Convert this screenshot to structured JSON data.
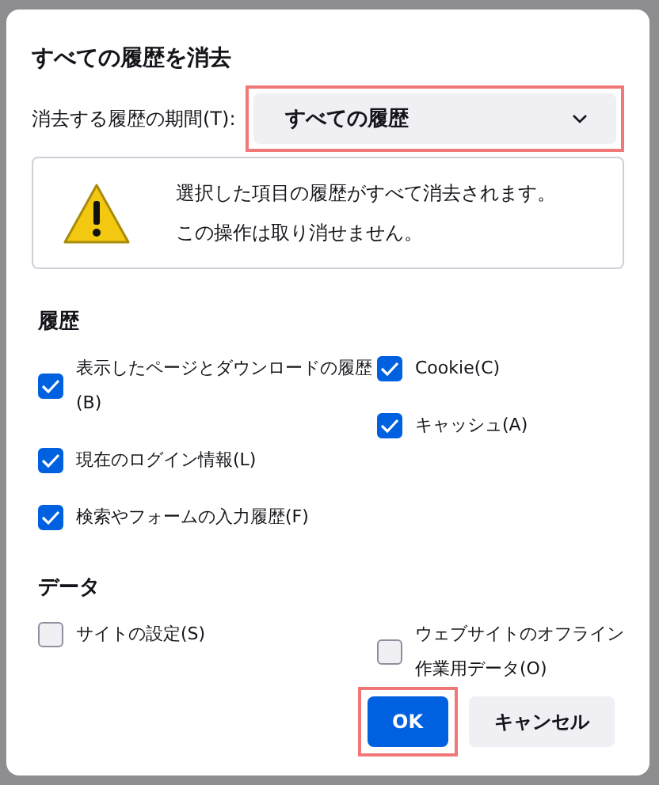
{
  "dialog": {
    "title": "すべての履歴を消去",
    "range": {
      "label": "消去する履歴の期間(T):",
      "value": "すべての履歴",
      "highlighted": true
    },
    "warning": {
      "lines": [
        "選択した項目の履歴がすべて消去されます。",
        "この操作は取り消せません。"
      ]
    },
    "sections": [
      {
        "title": "履歴",
        "columns": [
          [
            {
              "label": "表示したページとダウンロードの履歴(B)",
              "checked": true
            },
            {
              "label": "現在のログイン情報(L)",
              "checked": true
            },
            {
              "label": "検索やフォームの入力履歴(F)",
              "checked": true
            }
          ],
          [
            {
              "label": "Cookie(C)",
              "checked": true
            },
            {
              "label": "キャッシュ(A)",
              "checked": true
            }
          ]
        ]
      },
      {
        "title": "データ",
        "columns": [
          [
            {
              "label": "サイトの設定(S)",
              "checked": false
            }
          ],
          [
            {
              "label": "ウェブサイトのオフライン作業用データ(O)",
              "checked": false
            }
          ]
        ]
      }
    ],
    "buttons": [
      {
        "label": "OK",
        "kind": "primary",
        "highlighted": true
      },
      {
        "label": "キャンセル",
        "kind": "secondary",
        "highlighted": false
      }
    ]
  }
}
